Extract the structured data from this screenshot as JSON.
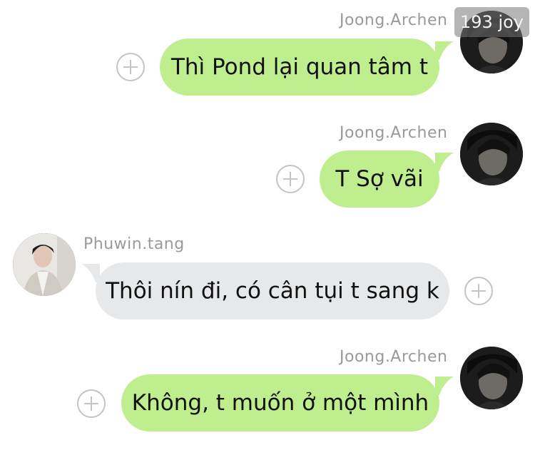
{
  "messages": [
    {
      "sender": "Joong.Archen",
      "text": "Thì Pond lại quan tâm t",
      "direction": "outgoing"
    },
    {
      "sender": "Joong.Archen",
      "text": "T Sợ vãi",
      "direction": "outgoing"
    },
    {
      "sender": "Phuwin.tang",
      "text": "Thôi nín đi, có cân tụi t sang k",
      "direction": "incoming"
    },
    {
      "sender": "Joong.Archen",
      "text": "Không, t muốn ở một mình",
      "direction": "outgoing"
    }
  ],
  "watermark": "193 joy",
  "colors": {
    "outgoing_bubble": "#bfee8e",
    "incoming_bubble": "#e6e8ea",
    "sender_name": "#9a9a9a"
  },
  "icons": {
    "add_reaction": "plus-circle-icon"
  }
}
